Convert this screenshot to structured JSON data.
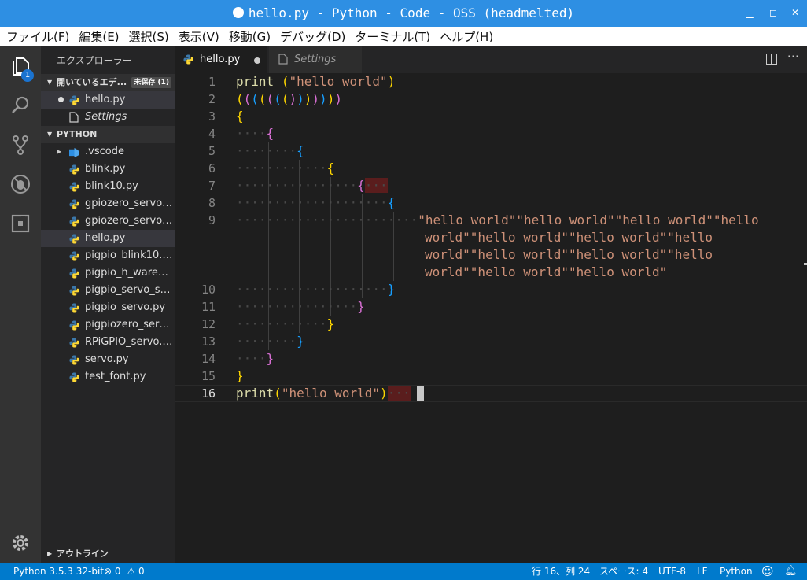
{
  "window": {
    "title": "hello.py - Python - Code - OSS (headmelted)"
  },
  "menu": [
    "ファイル(F)",
    "編集(E)",
    "選択(S)",
    "表示(V)",
    "移動(G)",
    "デバッグ(D)",
    "ターミナル(T)",
    "ヘルプ(H)"
  ],
  "activity": {
    "explorer_badge": "1"
  },
  "sidebar": {
    "title": "エクスプローラー",
    "open_editors": {
      "label": "開いているエデ...",
      "badge": "未保存 (1)",
      "items": [
        "hello.py",
        "Settings"
      ]
    },
    "folder": {
      "label": "PYTHON",
      "items": [
        ".vscode",
        "blink.py",
        "blink10.py",
        "gpiozero_servo_...",
        "gpiozero_servo_f...",
        "hello.py",
        "pigpio_blink10.py",
        "pigpio_h_ware_s...",
        "pigpio_servo_ser...",
        "pigpio_servo.py",
        "pigpiozero_servo...",
        "RPiGPIO_servo.py",
        "servo.py",
        "test_font.py"
      ]
    },
    "outline": "アウトライン"
  },
  "tabs": [
    {
      "label": "hello.py"
    },
    {
      "label": "Settings"
    }
  ],
  "editor": {
    "line_numbers": [
      "1",
      "2",
      "3",
      "4",
      "5",
      "6",
      "7",
      "8",
      "9",
      "10",
      "11",
      "12",
      "13",
      "14",
      "15",
      "16"
    ],
    "line1_kw": "print",
    "line1_str": "\"hello world\"",
    "line9_a": "\"hello world\"\"hello world\"\"hello world\"\"hello",
    "line9_b": "world\"\"hello world\"\"hello world\"\"hello",
    "line9_c": "world\"\"hello world\"\"hello world\"\"hello",
    "line9_d": "world\"\"hello world\"\"hello world\"",
    "line16_kw": "print",
    "line16_str": "\"hello world\""
  },
  "status": {
    "interpreter": "Python 3.5.3 32-bit",
    "errors": "0",
    "warnings": "0",
    "position": "行 16、列 24",
    "spaces": "スペース: 4",
    "encoding": "UTF-8",
    "eol": "LF",
    "language": "Python"
  },
  "colors": {
    "titlebar": "#2e8fe3",
    "statusbar": "#007acc",
    "bracket_gold": "#ffd700",
    "bracket_orchid": "#da70d6",
    "bracket_blue": "#179fff",
    "string": "#ce9178"
  }
}
